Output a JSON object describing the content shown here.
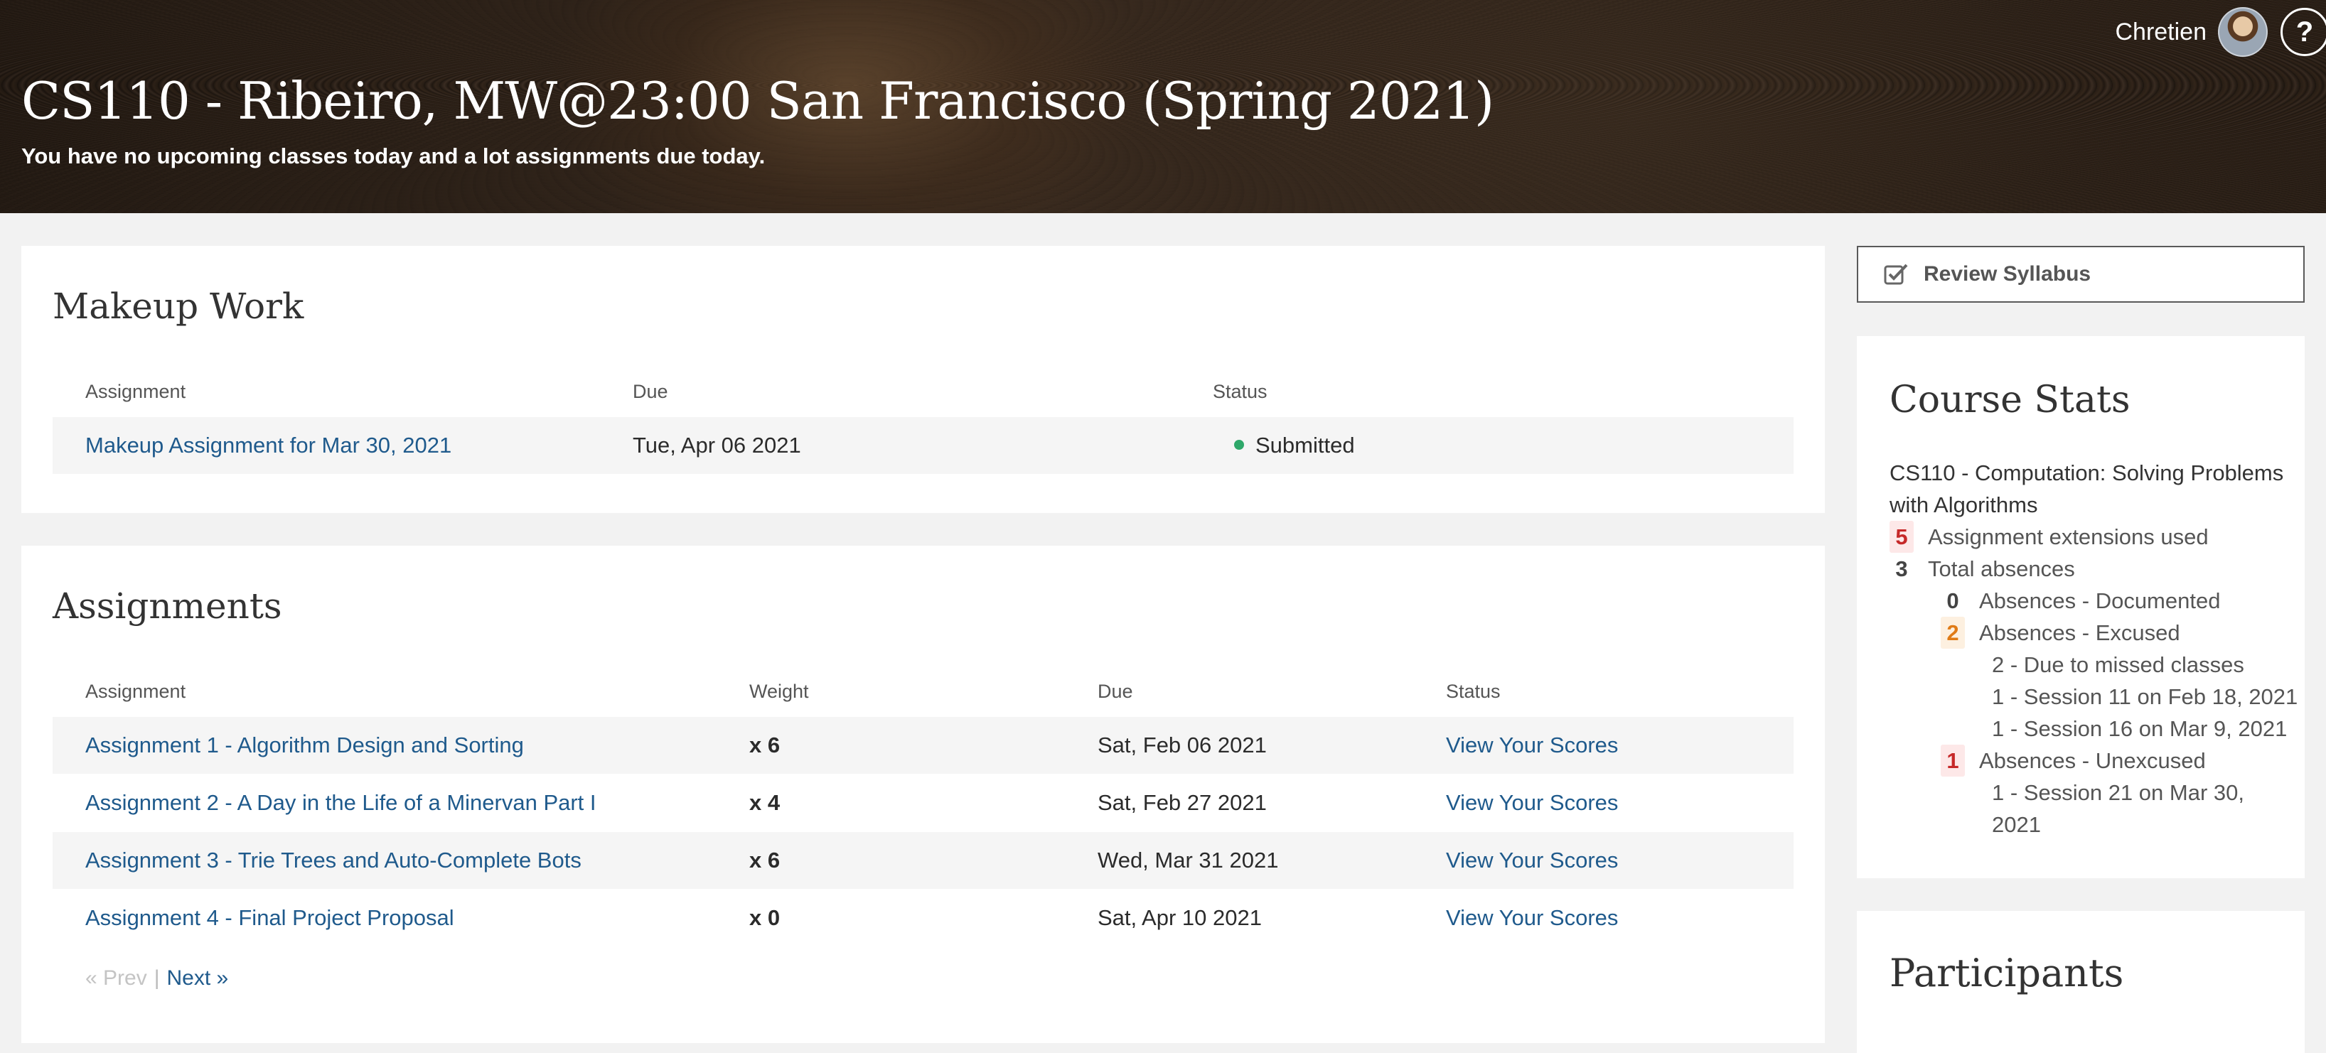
{
  "header": {
    "course_title": "CS110 - Ribeiro, MW@23:00 San Francisco (Spring 2021)",
    "subtitle": "You have no upcoming classes today and a lot assignments due today.",
    "user_name": "Chretien",
    "help_label": "?"
  },
  "makeup": {
    "title": "Makeup Work",
    "columns": [
      "Assignment",
      "Due",
      "Status"
    ],
    "rows": [
      {
        "assignment": "Makeup Assignment for Mar 30, 2021",
        "due": "Tue, Apr 06 2021",
        "status": "Submitted"
      }
    ]
  },
  "assignments": {
    "title": "Assignments",
    "columns": [
      "Assignment",
      "Weight",
      "Due",
      "Status"
    ],
    "rows": [
      {
        "name": "Assignment 1 - Algorithm Design and Sorting",
        "weight": "x 6",
        "due": "Sat, Feb 06 2021",
        "status": "View Your Scores"
      },
      {
        "name": "Assignment 2 - A Day in the Life of a Minervan Part I",
        "weight": "x 4",
        "due": "Sat, Feb 27 2021",
        "status": "View Your Scores"
      },
      {
        "name": "Assignment 3 - Trie Trees and Auto-Complete Bots",
        "weight": "x 6",
        "due": "Wed, Mar 31 2021",
        "status": "View Your Scores"
      },
      {
        "name": "Assignment 4 - Final Project Proposal",
        "weight": "x 0",
        "due": "Sat, Apr 10 2021",
        "status": "View Your Scores"
      }
    ],
    "pager": {
      "prev": "« Prev",
      "separator": "|",
      "next": "Next »"
    }
  },
  "sidebar": {
    "review_syllabus": "Review Syllabus",
    "stats": {
      "title": "Course Stats",
      "course_name": "CS110 - Computation: Solving Problems with Algorithms",
      "extensions": {
        "count": "5",
        "label": "Assignment extensions used"
      },
      "total_absences": {
        "count": "3",
        "label": "Total absences"
      },
      "documented": {
        "count": "0",
        "label": "Absences - Documented"
      },
      "excused": {
        "count": "2",
        "label": "Absences - Excused"
      },
      "excused_detail": [
        "2 - Due to missed classes",
        "1 - Session 11 on Feb 18, 2021",
        "1 - Session 16 on Mar 9, 2021"
      ],
      "unexcused": {
        "count": "1",
        "label": "Absences - Unexcused"
      },
      "unexcused_detail": [
        "1 - Session 21 on Mar 30,",
        "2021"
      ]
    },
    "participants_title": "Participants"
  },
  "colors": {
    "link": "#1f5a8c",
    "status_submitted": "#2fa86a",
    "badge_red": "#c62828",
    "badge_orange": "#e07b16"
  }
}
